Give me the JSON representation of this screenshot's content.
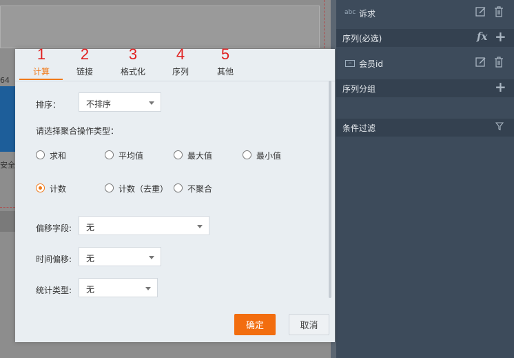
{
  "background": {
    "number_fragment": "64",
    "text_fragment": "安全"
  },
  "right_panel": {
    "top_field": {
      "type_badge": "abc",
      "label": "诉求"
    },
    "sequence_required": {
      "label": "序列(必选)",
      "fx_label": "fx"
    },
    "sequence_field": {
      "label": "会员id"
    },
    "sequence_group": {
      "label": "序列分组"
    },
    "condition_filter": {
      "label": "条件过滤"
    }
  },
  "dialog": {
    "tabs": [
      {
        "number": "1",
        "label": "计算",
        "active": true
      },
      {
        "number": "2",
        "label": "链接",
        "active": false
      },
      {
        "number": "3",
        "label": "格式化",
        "active": false
      },
      {
        "number": "4",
        "label": "序列",
        "active": false
      },
      {
        "number": "5",
        "label": "其他",
        "active": false
      }
    ],
    "sort": {
      "label": "排序：",
      "value": "不排序"
    },
    "aggregate_prompt": "请选择聚合操作类型：",
    "aggregate_options": [
      {
        "label": "求和",
        "checked": false
      },
      {
        "label": "平均值",
        "checked": false
      },
      {
        "label": "最大值",
        "checked": false
      },
      {
        "label": "最小值",
        "checked": false
      },
      {
        "label": "计数",
        "checked": true
      },
      {
        "label": "计数（去重）",
        "checked": false
      },
      {
        "label": "不聚合",
        "checked": false
      }
    ],
    "offset_field": {
      "label": "偏移字段:",
      "value": "无"
    },
    "time_offset": {
      "label": "时间偏移:",
      "value": "无"
    },
    "stat_type": {
      "label": "统计类型:",
      "value": "无"
    },
    "confirm_label": "确定",
    "cancel_label": "取消"
  },
  "colors": {
    "accent": "#f07a1a",
    "confirm_button": "#f26d0f",
    "tab_number": "#e02020",
    "right_panel_bg": "#3d4b5b"
  }
}
